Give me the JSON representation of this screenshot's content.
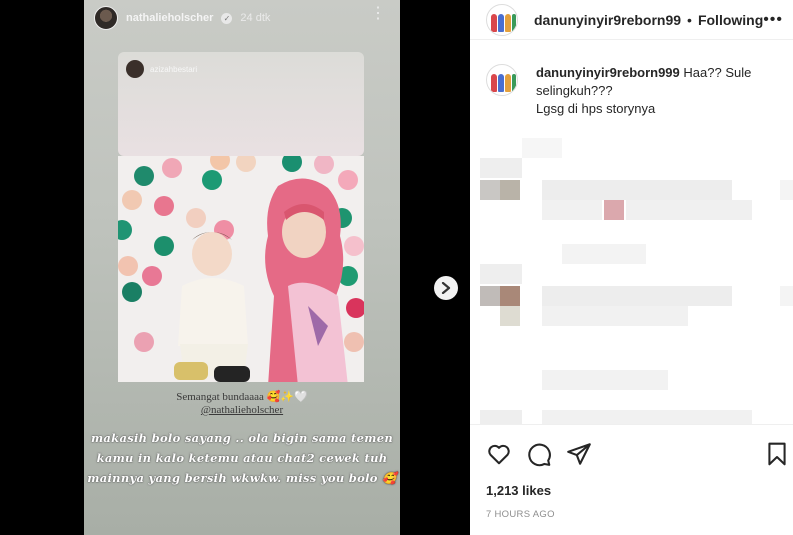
{
  "story": {
    "username": "nathalieholscher",
    "time": "24 dtk",
    "card_username": "azizahbestari",
    "caption_line1": "Semangat bundaaaa 🥰✨🤍",
    "caption_line2": "@nathalieholscher",
    "text": "makasih bolo sayang .. ola bigin sama temen kamu in kalo ketemu atau chat2 cewek tuh mainnya yang bersih wkwkw. miss you bolo 🥰"
  },
  "post": {
    "username": "danunyinyir9reborn99",
    "follow_label": "Following",
    "comment_username": "danunyinyir9reborn999",
    "comment_text": "Haa?? Sule selingkuh???",
    "comment_text2": "Lgsg di hps storynya",
    "likes": "1,213 likes",
    "time_ago": "7 HOURS AGO"
  },
  "icons": {
    "more": "more-options-icon",
    "next": "chevron-right-icon",
    "like": "heart-icon",
    "comment": "comment-icon",
    "share": "share-icon",
    "save": "bookmark-icon"
  }
}
